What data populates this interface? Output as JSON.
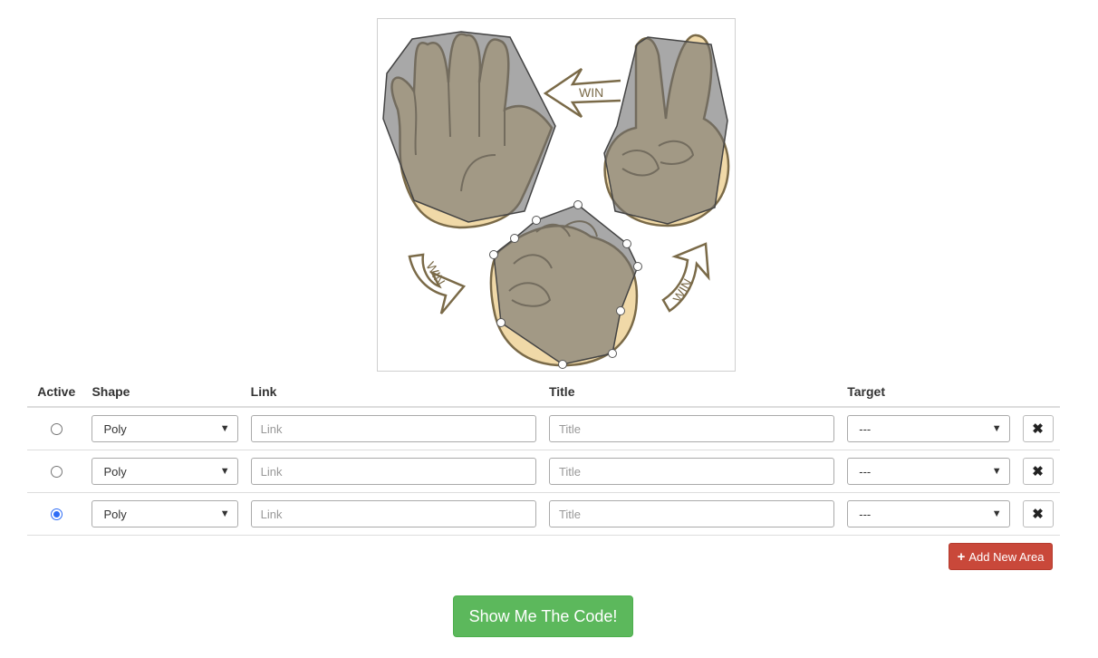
{
  "image": {
    "arrow_labels": [
      "WIN",
      "WIN",
      "WIN"
    ]
  },
  "table": {
    "headers": {
      "active": "Active",
      "shape": "Shape",
      "link": "Link",
      "title": "Title",
      "target": "Target"
    },
    "rows": [
      {
        "active": false,
        "shape": "Poly",
        "link_placeholder": "Link",
        "title_placeholder": "Title",
        "target": "---"
      },
      {
        "active": false,
        "shape": "Poly",
        "link_placeholder": "Link",
        "title_placeholder": "Title",
        "target": "---"
      },
      {
        "active": true,
        "shape": "Poly",
        "link_placeholder": "Link",
        "title_placeholder": "Title",
        "target": "---"
      }
    ],
    "delete_icon": "close-icon"
  },
  "buttons": {
    "add_new_area": "Add New Area",
    "show_code": "Show Me The Code!"
  },
  "colors": {
    "danger": "#c9483a",
    "success": "#5cb85c",
    "radio_active": "#2f6df6"
  }
}
